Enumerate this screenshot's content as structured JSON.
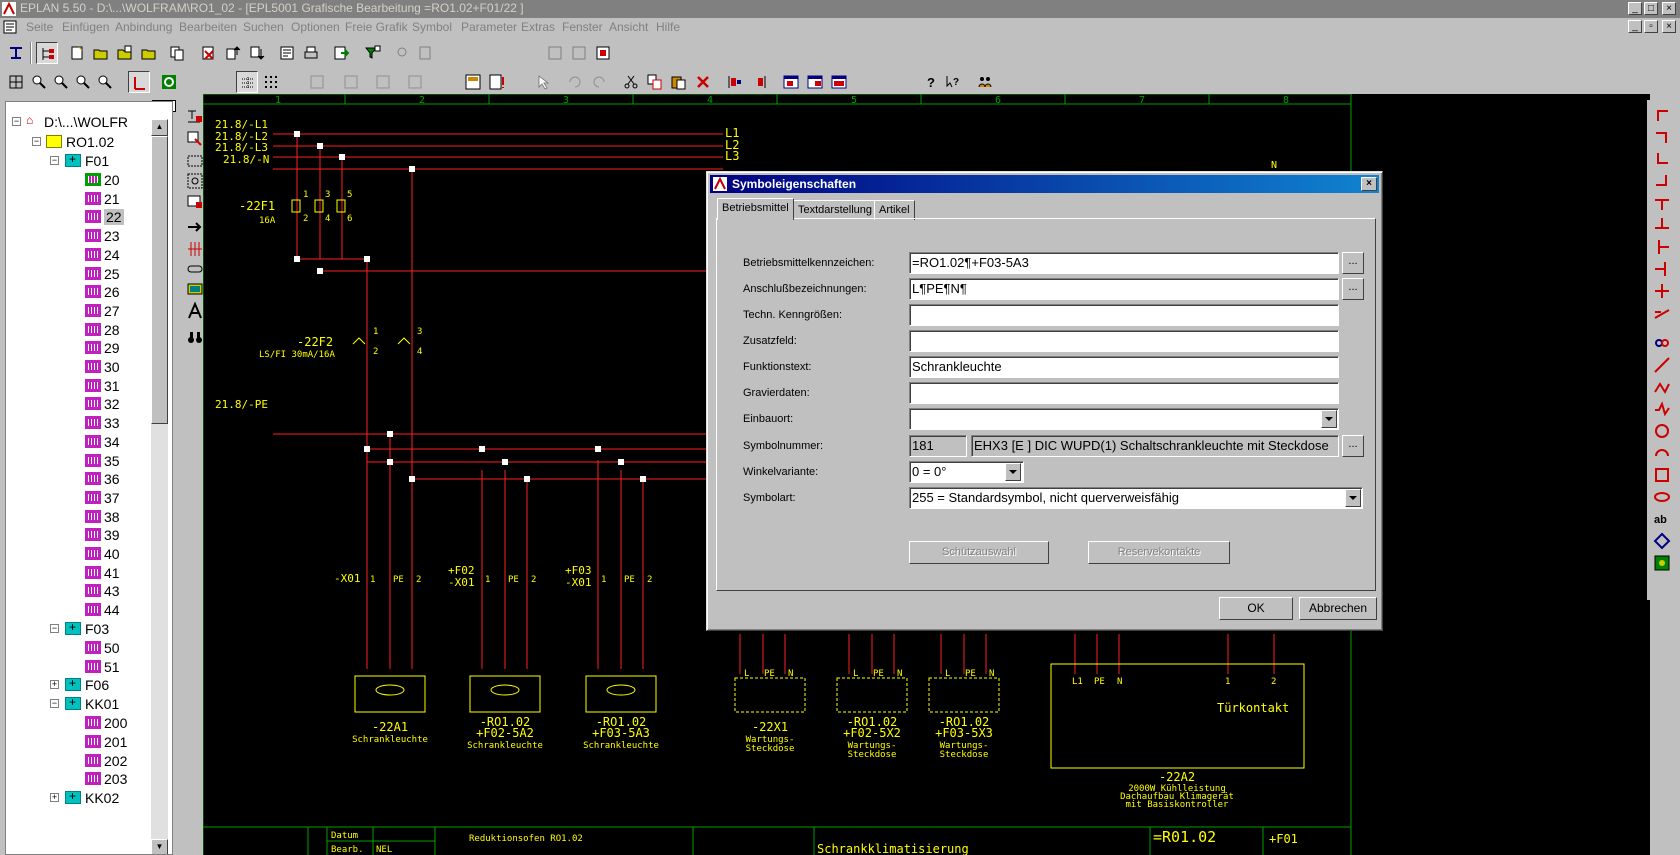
{
  "titlebar": {
    "text": "EPLAN 5.50 - D:\\...\\WOLFRAM\\RO1_02 - [EPL5001 Grafische Bearbeitung =RO1.02+F01/22   ]"
  },
  "menu": [
    "Seite",
    "Einfügen",
    "Anbindung",
    "Bearbeiten",
    "Suchen",
    "Optionen",
    "Freie Grafik",
    "Symbol",
    "Parameter",
    "Extras",
    "Fenster",
    "Ansicht",
    "Hilfe"
  ],
  "tree": {
    "root": "D:\\...\\WOLFR",
    "project": "RO1.02",
    "groups": [
      {
        "label": "F01",
        "expanded": true,
        "pages": [
          "20",
          "21",
          "22",
          "23",
          "24",
          "25",
          "26",
          "27",
          "28",
          "29",
          "30",
          "31",
          "32",
          "33",
          "34",
          "35",
          "36",
          "37",
          "38",
          "39",
          "40",
          "41",
          "43",
          "44"
        ],
        "selected": "22"
      },
      {
        "label": "F03",
        "expanded": true,
        "pages": [
          "50",
          "51"
        ]
      },
      {
        "label": "F06",
        "expanded": false,
        "pages": []
      },
      {
        "label": "KK01",
        "expanded": true,
        "pages": [
          "200",
          "201",
          "202",
          "203"
        ]
      },
      {
        "label": "KK02",
        "expanded": false,
        "pages": []
      }
    ]
  },
  "ruler": [
    "1",
    "2",
    "3",
    "4",
    "5",
    "6",
    "7",
    "8"
  ],
  "schematic": {
    "refs": [
      "21.8/-L1",
      "21.8/-L2",
      "21.8/-L3",
      "21.8/-N",
      "21.8/-PE"
    ],
    "busLabels": [
      "L1",
      "L2",
      "L3",
      "N"
    ],
    "fuse1": {
      "name": "-22F1",
      "rating": "16A",
      "pins": [
        "1",
        "2",
        "3",
        "4",
        "5",
        "6"
      ]
    },
    "fuse2": {
      "name": "-22F2",
      "desc": "LS/FI 30mA/16A",
      "pins": [
        "1",
        "2",
        "3",
        "4"
      ]
    },
    "terminals": [
      {
        "top": "",
        "name": "-X01",
        "pins": [
          "1",
          "PE",
          "2"
        ]
      },
      {
        "top": "+F02",
        "name": "-X01",
        "pins": [
          "1",
          "PE",
          "2"
        ]
      },
      {
        "top": "+F03",
        "name": "-X01",
        "pins": [
          "1",
          "PE",
          "2"
        ]
      }
    ],
    "devices": [
      {
        "name": "-22A1",
        "name2": "",
        "desc": "Schrankleuchte",
        "desc2": ""
      },
      {
        "name": "-RO1.02",
        "name2": "+F02-5A2",
        "desc": "Schrankleuchte",
        "desc2": ""
      },
      {
        "name": "-RO1.02",
        "name2": "+F03-5A3",
        "desc": "Schrankleuchte",
        "desc2": ""
      },
      {
        "name": "-22X1",
        "name2": "",
        "desc": "Wartungs-",
        "desc2": "Steckdose"
      },
      {
        "name": "-RO1.02",
        "name2": "+F02-5X2",
        "desc": "Wartungs-",
        "desc2": "Steckdose"
      },
      {
        "name": "-RO1.02",
        "name2": "+F03-5X3",
        "desc": "Wartungs-",
        "desc2": "Steckdose"
      }
    ],
    "devicePins": [
      "L",
      "PE",
      "N"
    ],
    "bigBox": {
      "pins": [
        "L1",
        "PE",
        "N",
        "1",
        "2"
      ],
      "label": "Türkontakt",
      "name": "-22A2",
      "desc": [
        "2000W Kühlleistung",
        "Dachaufbau Klimagerät",
        "mit Basiskontroller"
      ]
    },
    "partialTop": "N",
    "titleblock": {
      "datum": "Datum",
      "bearb": "Bearb.",
      "bearbValue": "NEL",
      "project": "Reduktionsofen RO1.02",
      "anlage": "=R01.02",
      "ort": "+F01",
      "page_title": "Schrankklimatisierung"
    }
  },
  "dialog": {
    "title": "Symboleigenschaften",
    "tabs": [
      "Betriebsmittel",
      "Textdarstellung",
      "Artikel"
    ],
    "fields": {
      "bmk_label": "Betriebsmittelkennzeichen:",
      "bmk_value": "=RO1.02¶+F03-5A3",
      "ansch_label": "Anschlußbezeichnungen:",
      "ansch_value": "L¶PE¶N¶",
      "techn_label": "Techn. Kenngrößen:",
      "techn_value": "",
      "zusatz_label": "Zusatzfeld:",
      "zusatz_value": "",
      "funk_label": "Funktionstext:",
      "funk_value": "Schrankleuchte",
      "grav_label": "Gravierdaten:",
      "grav_value": "",
      "einbau_label": "Einbauort:",
      "einbau_value": "",
      "symnr_label": "Symbolnummer:",
      "symnr_value": "181",
      "symnr_desc": "EHX3 [E  ] DIC  WUPD(1) Schaltschrankleuchte mit Steckdose",
      "winkel_label": "Winkelvariante:",
      "winkel_value": "0 = 0°",
      "symart_label": "Symbolart:",
      "symart_value": "255 = Standardsymbol, nicht querverweisfähig"
    },
    "buttons": {
      "schuetz": "Schützauswahl",
      "reserve": "Reservekontakte",
      "ok": "OK",
      "cancel": "Abbrechen",
      "dots": "..."
    }
  },
  "colors": {
    "drawing_bg": "#000000",
    "wire": "#ff2020",
    "symbol": "#ffff00",
    "frame": "#00a000",
    "dialog_title": "#000080"
  }
}
